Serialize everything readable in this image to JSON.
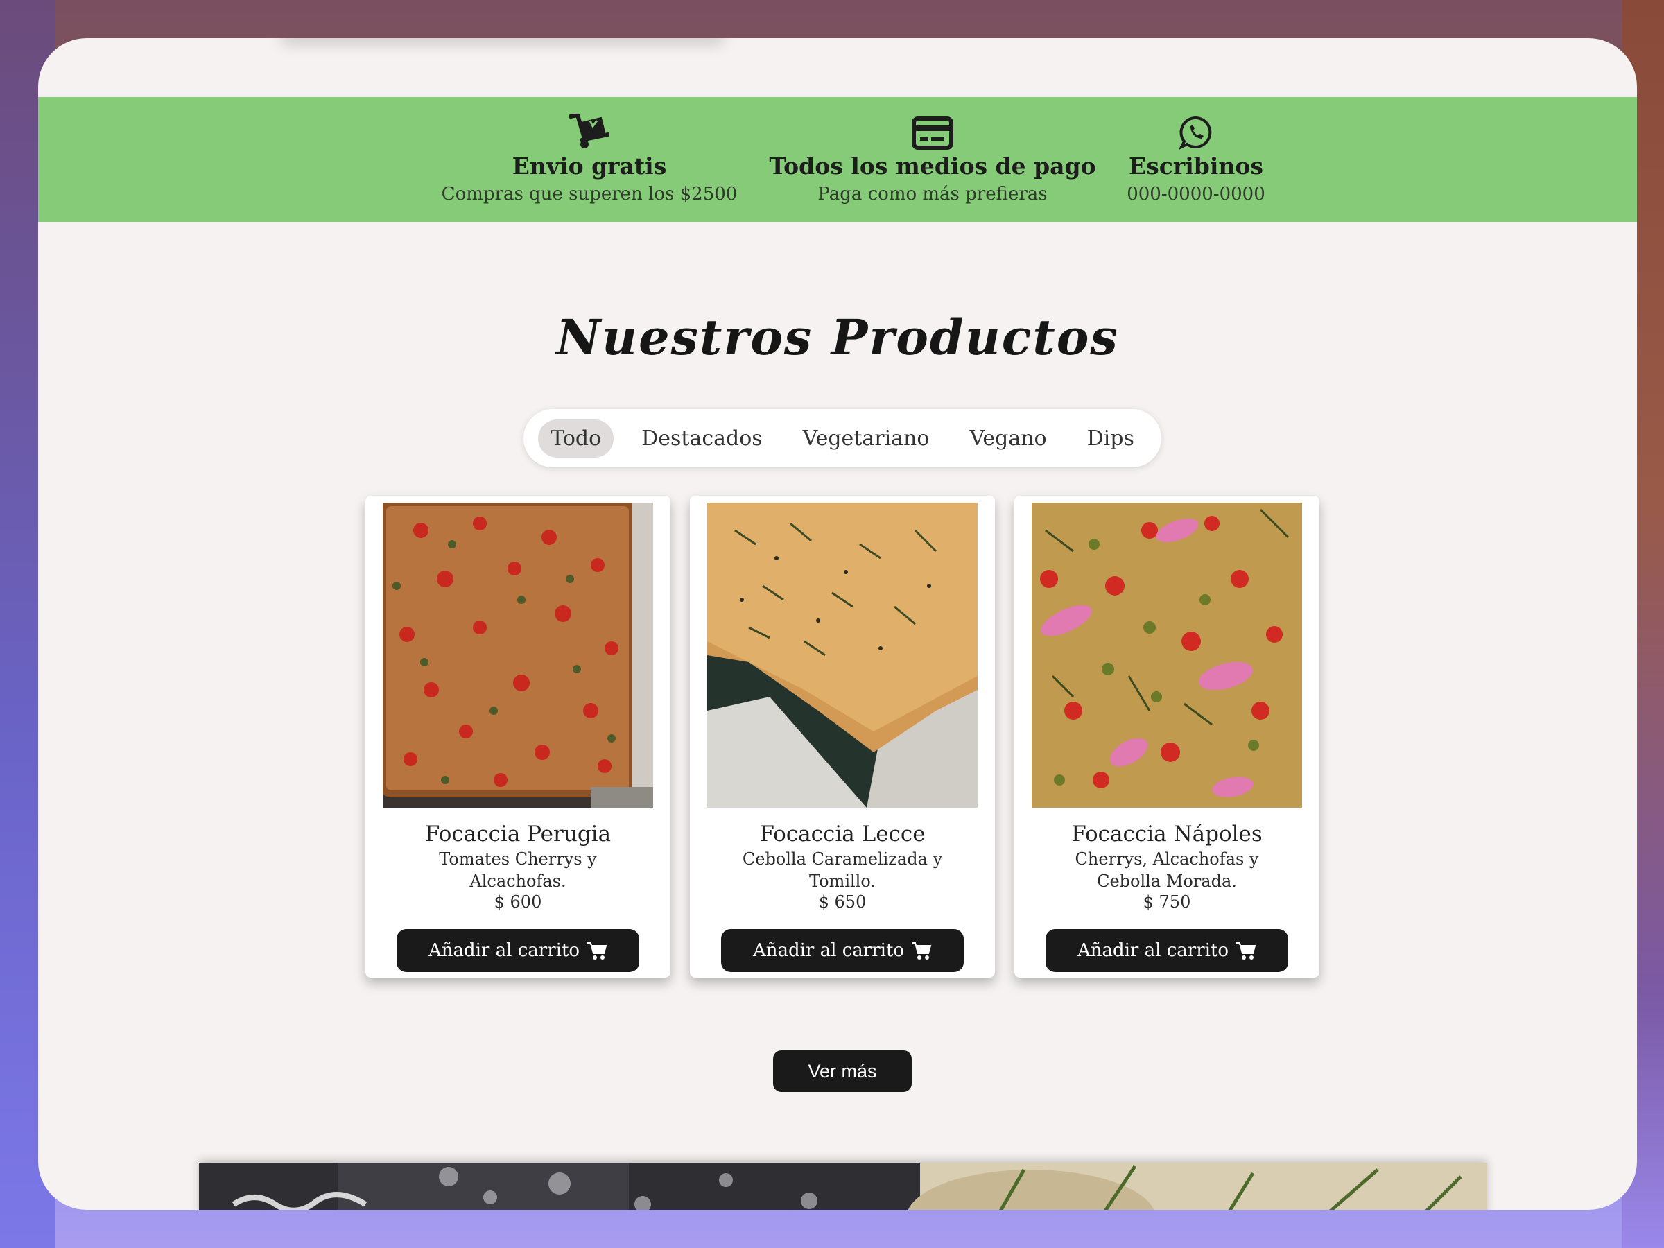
{
  "benefits": [
    {
      "icon": "hand-truck-icon",
      "title": "Envio gratis",
      "subtitle": "Compras que superen los $2500"
    },
    {
      "icon": "credit-card-icon",
      "title": "Todos los medios de pago",
      "subtitle": "Paga como más prefieras"
    },
    {
      "icon": "whatsapp-icon",
      "title": "Escribinos",
      "subtitle": "000-0000-0000"
    }
  ],
  "products_section": {
    "title": "Nuestros Productos",
    "filters": [
      "Todo",
      "Destacados",
      "Vegetariano",
      "Vegano",
      "Dips"
    ],
    "active_filter": "Todo",
    "products": [
      {
        "name": "Focaccia Perugia",
        "description": "Tomates Cherrys y Alcachofas.",
        "price": "$ 600",
        "button_label": "Añadir al carrito"
      },
      {
        "name": "Focaccia Lecce",
        "description": "Cebolla Caramelizada y Tomillo.",
        "price": "$ 650",
        "button_label": "Añadir al carrito"
      },
      {
        "name": "Focaccia Nápoles",
        "description": "Cherrys, Alcachofas y Cebolla Morada.",
        "price": "$ 750",
        "button_label": "Añadir al carrito"
      }
    ],
    "more_button": "Ver más"
  },
  "colors": {
    "benefits_bar": "#86cc78",
    "button": "#1a1a1a",
    "page": "#f5f2f1"
  }
}
